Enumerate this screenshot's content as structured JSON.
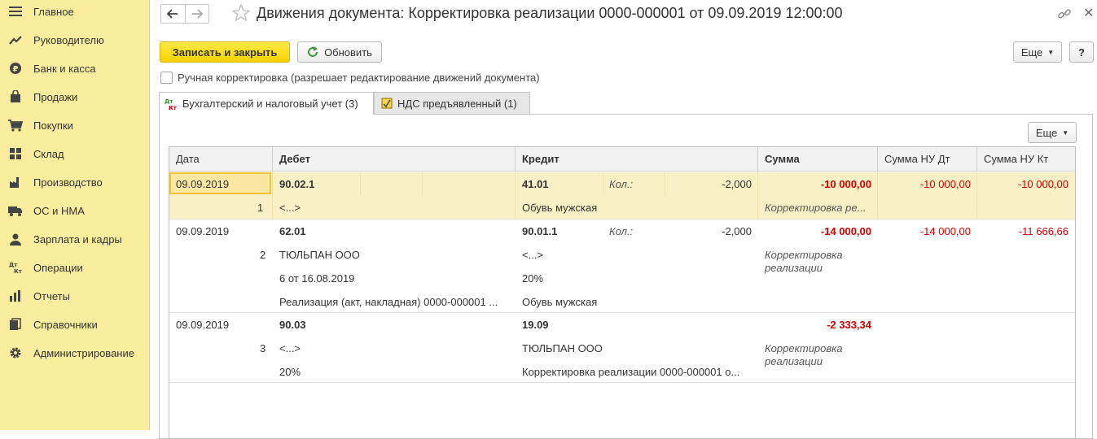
{
  "sidebar": {
    "items": [
      {
        "label": "Главное",
        "icon": "menu-icon"
      },
      {
        "label": "Руководителю",
        "icon": "trend-icon"
      },
      {
        "label": "Банк и касса",
        "icon": "ruble-icon"
      },
      {
        "label": "Продажи",
        "icon": "bag-icon"
      },
      {
        "label": "Покупки",
        "icon": "cart-icon"
      },
      {
        "label": "Склад",
        "icon": "grid-icon"
      },
      {
        "label": "Производство",
        "icon": "factory-icon"
      },
      {
        "label": "ОС и НМА",
        "icon": "truck-icon"
      },
      {
        "label": "Зарплата и кадры",
        "icon": "person-icon"
      },
      {
        "label": "Операции",
        "icon": "dt-kt-icon"
      },
      {
        "label": "Отчеты",
        "icon": "bar-chart-icon"
      },
      {
        "label": "Справочники",
        "icon": "books-icon"
      },
      {
        "label": "Администрирование",
        "icon": "gear-icon"
      }
    ]
  },
  "header": {
    "title": "Движения документа: Корректировка реализации 0000-000001 от 09.09.2019 12:00:00"
  },
  "toolbar": {
    "save_close": "Записать и закрыть",
    "refresh": "Обновить",
    "more": "Еще",
    "help": "?"
  },
  "manual_edit": {
    "label": "Ручная корректировка (разрешает редактирование движений документа)",
    "checked": false
  },
  "tabs": [
    {
      "label": "Бухгалтерский и налоговый учет (3)",
      "active": true,
      "icon": "dt-kt-icon"
    },
    {
      "label": "НДС предъявленный (1)",
      "active": false,
      "icon": "register-icon"
    }
  ],
  "grid": {
    "more": "Еще",
    "headers": [
      "Дата",
      "Дебет",
      "Кредит",
      "Сумма",
      "Сумма НУ Дт",
      "Сумма НУ Кт"
    ],
    "records": [
      {
        "num": "1",
        "date": "09.09.2019",
        "debit_account": "90.02.1",
        "debit_sub": [
          "<...>"
        ],
        "credit_account": "41.01",
        "qty_label": "Кол.:",
        "qty": "-2,000",
        "credit_sub": [
          "Обувь мужская"
        ],
        "amount": "-10 000,00",
        "content": "Корректировка ре...",
        "nu_dt": "-10 000,00",
        "nu_kt": "-10 000,00"
      },
      {
        "num": "2",
        "date": "09.09.2019",
        "debit_account": "62.01",
        "debit_sub": [
          "ТЮЛЬПАН ООО",
          "6 от 16.08.2019",
          "Реализация (акт, накладная) 0000-000001 ..."
        ],
        "credit_account": "90.01.1",
        "qty_label": "Кол.:",
        "qty": "-2,000",
        "credit_sub": [
          "<...>",
          "20%",
          "Обувь мужская"
        ],
        "amount": "-14 000,00",
        "content": "Корректировка реализации",
        "nu_dt": "-14 000,00",
        "nu_kt": "-11 666,66"
      },
      {
        "num": "3",
        "date": "09.09.2019",
        "debit_account": "90.03",
        "debit_sub": [
          "<...>",
          "20%"
        ],
        "credit_account": "19.09",
        "qty_label": "",
        "qty": "",
        "credit_sub": [
          "ТЮЛЬПАН ООО",
          "Корректировка реализации 0000-000001 о..."
        ],
        "amount": "-2 333,34",
        "content": "Корректировка реализации",
        "nu_dt": "",
        "nu_kt": ""
      }
    ]
  },
  "colors": {
    "sidebar_bg": "#fbed9e",
    "primary_button": "#f5d200",
    "selected_row": "#faf0c5",
    "negative_amount": "#d40000"
  }
}
